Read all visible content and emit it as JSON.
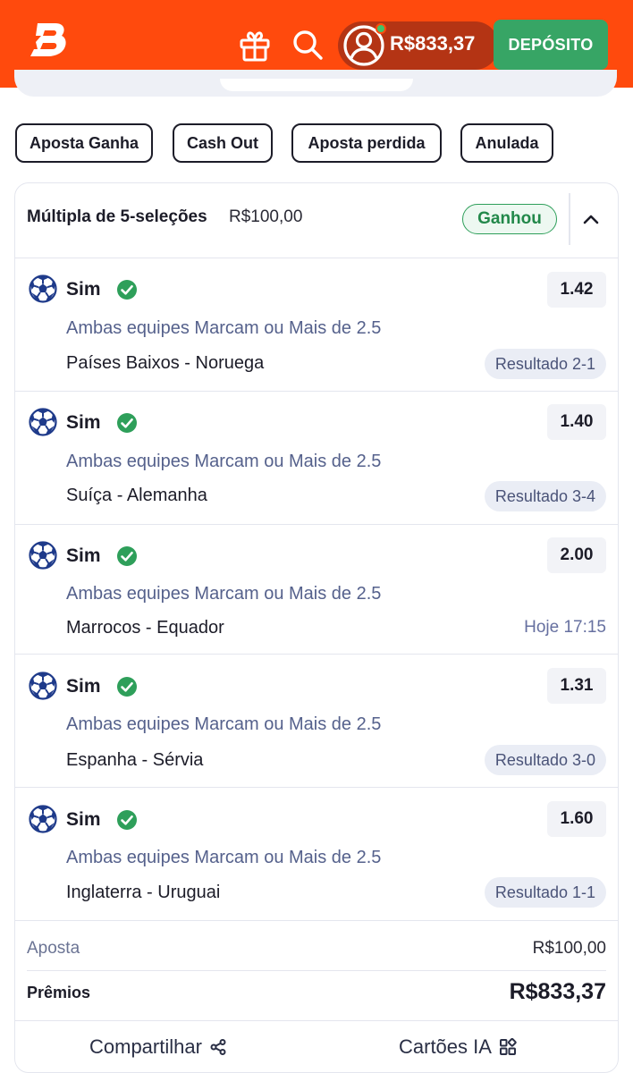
{
  "header": {
    "logo_icon": "brand-b-logo",
    "balance": "R$833,37",
    "deposit_label": "DEPÓSITO",
    "colors": {
      "header_bg": "#ff4a0d",
      "deposit_bg": "#37a565",
      "online": "#3fc46a"
    }
  },
  "filters": [
    {
      "label": "Aposta Ganha"
    },
    {
      "label": "Cash Out"
    },
    {
      "label": "Aposta perdida"
    },
    {
      "label": "Anulada"
    }
  ],
  "bet": {
    "title": "Múltipla de 5-seleções",
    "stake_display": "R$100,00",
    "status": "Ganhou",
    "selections": [
      {
        "pick": "Sim",
        "odds": "1.42",
        "market": "Ambas equipes Marcam ou Mais de 2.5",
        "match": "Países Baixos - Noruega",
        "result": "Resultado 2-1"
      },
      {
        "pick": "Sim",
        "odds": "1.40",
        "market": "Ambas equipes Marcam ou Mais de 2.5",
        "match": "Suíça - Alemanha",
        "result": "Resultado 3-4"
      },
      {
        "pick": "Sim",
        "odds": "2.00",
        "market": "Ambas equipes Marcam ou Mais de 2.5",
        "match": "Marrocos - Equador",
        "time": "Hoje 17:15"
      },
      {
        "pick": "Sim",
        "odds": "1.31",
        "market": "Ambas equipes Marcam ou Mais de 2.5",
        "match": "Espanha - Sérvia",
        "result": "Resultado 3-0"
      },
      {
        "pick": "Sim",
        "odds": "1.60",
        "market": "Ambas equipes Marcam ou Mais de 2.5",
        "match": "Inglaterra - Uruguai",
        "result": "Resultado 1-1"
      }
    ],
    "summary": {
      "stake_label": "Aposta",
      "stake_value": "R$100,00",
      "prize_label": "Prêmios",
      "prize_value": "R$833,37"
    },
    "status_color": "#2e9f5a"
  },
  "footer": {
    "share_label": "Compartilhar",
    "ai_cards_label": "Cartões IA"
  }
}
